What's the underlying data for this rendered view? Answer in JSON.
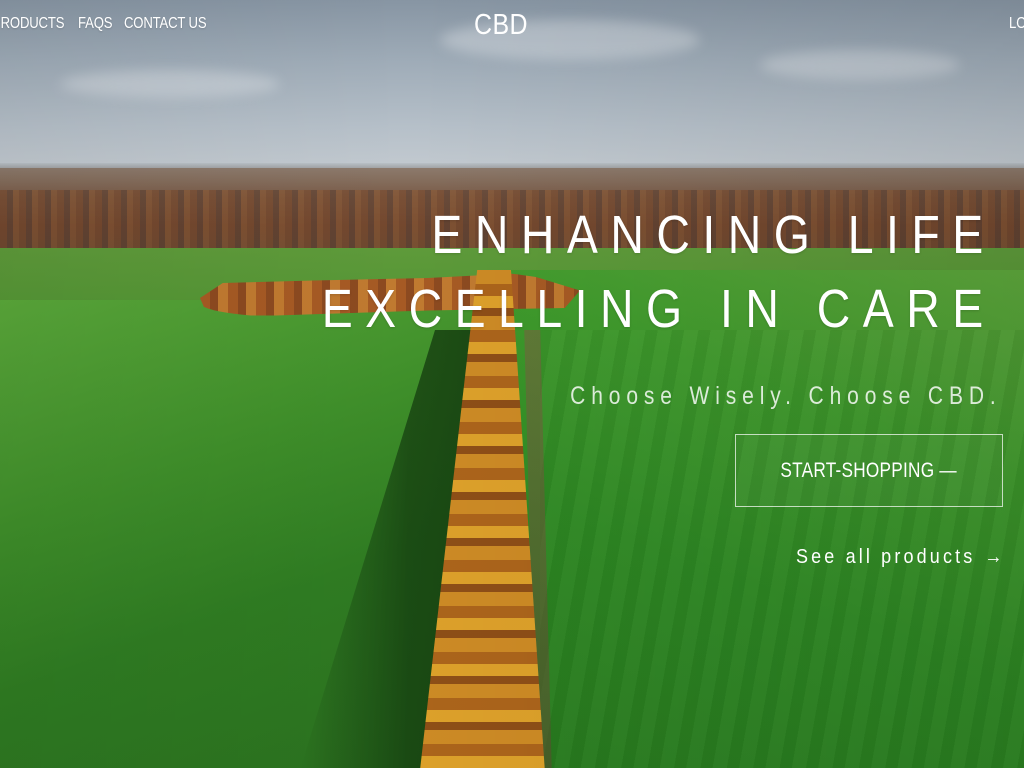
{
  "nav": {
    "left_links": [
      {
        "label": "PRODUCTS"
      },
      {
        "label": "FAQS"
      },
      {
        "label": "CONTACT US"
      }
    ],
    "logo": "CBD",
    "right_link": "LOGIN"
  },
  "hero": {
    "title_line1": "ENHANCING LIFE",
    "title_line2": "EXCELLING IN CARE",
    "tagline": "Choose Wisely. Choose CBD.",
    "cta_label": "START-SHOPPING —",
    "see_all_label": "See all products",
    "see_all_icon": "arrow-right-icon",
    "see_all_glyph": "→"
  },
  "colors": {
    "text": "#ffffff",
    "cta_border": "#ffffffb3",
    "field_green": "#3f8f2a",
    "foliage_orange": "#c98a2a",
    "sky": "#9eabb7"
  }
}
